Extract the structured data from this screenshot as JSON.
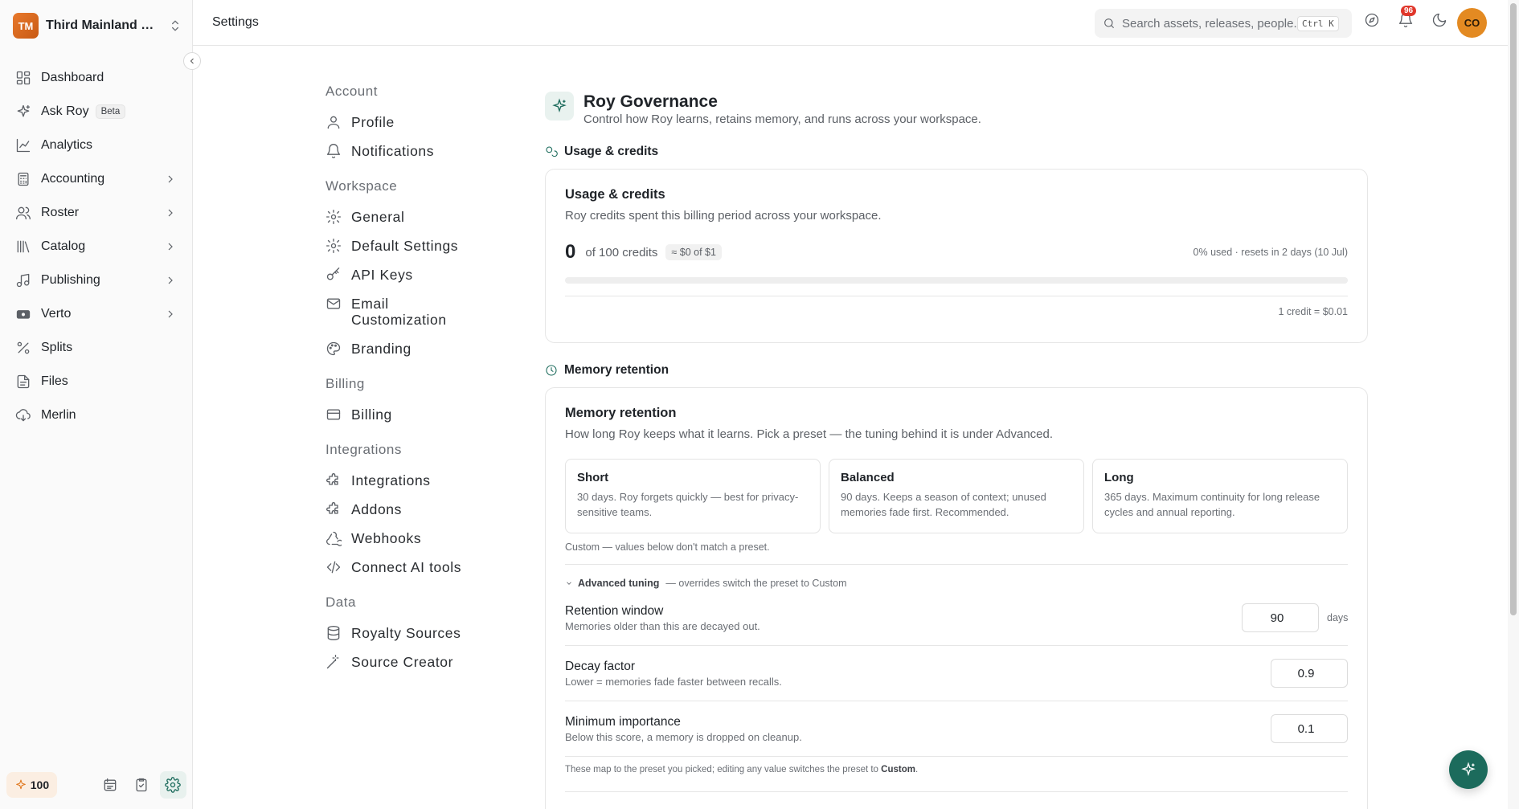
{
  "workspace": {
    "initials": "TM",
    "name": "Third Mainland Records"
  },
  "sidebar": {
    "items": [
      {
        "label": "Dashboard",
        "icon": "dashboard-icon",
        "chevron": false
      },
      {
        "label": "Ask Roy",
        "icon": "sparkle-icon",
        "chevron": false,
        "badge": "Beta"
      },
      {
        "label": "Analytics",
        "icon": "line-chart-icon",
        "chevron": false
      },
      {
        "label": "Accounting",
        "icon": "calculator-icon",
        "chevron": true
      },
      {
        "label": "Roster",
        "icon": "users-icon",
        "chevron": true
      },
      {
        "label": "Catalog",
        "icon": "library-icon",
        "chevron": true
      },
      {
        "label": "Publishing",
        "icon": "music-note-icon",
        "chevron": true
      },
      {
        "label": "Verto",
        "icon": "card-icon",
        "chevron": true
      },
      {
        "label": "Splits",
        "icon": "percent-icon",
        "chevron": false
      },
      {
        "label": "Files",
        "icon": "file-icon",
        "chevron": false
      },
      {
        "label": "Merlin",
        "icon": "cloud-download-icon",
        "chevron": false
      }
    ],
    "credits": "100"
  },
  "topbar": {
    "breadcrumb": "Settings",
    "search_placeholder": "Search assets, releases, people...",
    "search_shortcut": "Ctrl K",
    "notification_count": "96",
    "avatar_initials": "CO"
  },
  "settings_nav": {
    "groups": [
      {
        "title": "Account",
        "items": [
          {
            "label": "Profile",
            "icon": "user-icon"
          },
          {
            "label": "Notifications",
            "icon": "bell-icon"
          }
        ]
      },
      {
        "title": "Workspace",
        "items": [
          {
            "label": "General",
            "icon": "gear-icon"
          },
          {
            "label": "Default Settings",
            "icon": "gear-icon"
          },
          {
            "label": "API Keys",
            "icon": "key-icon"
          },
          {
            "label": "Email Customization",
            "icon": "mail-icon"
          },
          {
            "label": "Branding",
            "icon": "palette-icon"
          }
        ]
      },
      {
        "title": "Billing",
        "items": [
          {
            "label": "Billing",
            "icon": "credit-card-icon"
          }
        ]
      },
      {
        "title": "Integrations",
        "items": [
          {
            "label": "Integrations",
            "icon": "puzzle-icon"
          },
          {
            "label": "Addons",
            "icon": "puzzle-icon"
          },
          {
            "label": "Webhooks",
            "icon": "webhook-icon"
          },
          {
            "label": "Connect AI tools",
            "icon": "code-icon"
          }
        ]
      },
      {
        "title": "Data",
        "items": [
          {
            "label": "Royalty Sources",
            "icon": "database-icon"
          },
          {
            "label": "Source Creator",
            "icon": "wand-icon"
          }
        ]
      }
    ]
  },
  "page": {
    "title": "Roy Governance",
    "subtitle": "Control how Roy learns, retains memory, and runs across your workspace.",
    "usage_section_label": "Usage & credits",
    "usage": {
      "title": "Usage & credits",
      "subtitle": "Roy credits spent this billing period across your workspace.",
      "used": "0",
      "of_text": "of 100 credits",
      "cost_chip": "≈ $0 of $1",
      "status": "0% used · resets in 2 days (10 Jul)",
      "progress_fraction": 0,
      "rate": "1 credit = $0.01"
    },
    "memory_section_label": "Memory retention",
    "memory": {
      "title": "Memory retention",
      "subtitle": "How long Roy keeps what it learns. Pick a preset — the tuning behind it is under Advanced.",
      "presets": [
        {
          "title": "Short",
          "desc": "30 days. Roy forgets quickly — best for privacy-sensitive teams."
        },
        {
          "title": "Balanced",
          "desc": "90 days. Keeps a season of context; unused memories fade first. Recommended."
        },
        {
          "title": "Long",
          "desc": "365 days. Maximum continuity for long release cycles and annual reporting."
        }
      ],
      "custom_note": "Custom — values below don't match a preset.",
      "advanced_label": "Advanced tuning",
      "advanced_note": "— overrides switch the preset to Custom",
      "fields": [
        {
          "name": "Retention window",
          "desc": "Memories older than this are decayed out.",
          "value": "90",
          "unit": "days"
        },
        {
          "name": "Decay factor",
          "desc": "Lower = memories fade faster between recalls.",
          "value": "0.9",
          "unit": ""
        },
        {
          "name": "Minimum importance",
          "desc": "Below this score, a memory is dropped on cleanup.",
          "value": "0.1",
          "unit": ""
        }
      ],
      "map_note_prefix": "These map to the preset you picked; editing any value switches the preset to ",
      "map_note_bold": "Custom",
      "map_note_suffix": "."
    }
  },
  "colors": {
    "accent": "#1c6b5c",
    "brand_orange": "#e38a22",
    "badge_red": "#e0372b"
  }
}
